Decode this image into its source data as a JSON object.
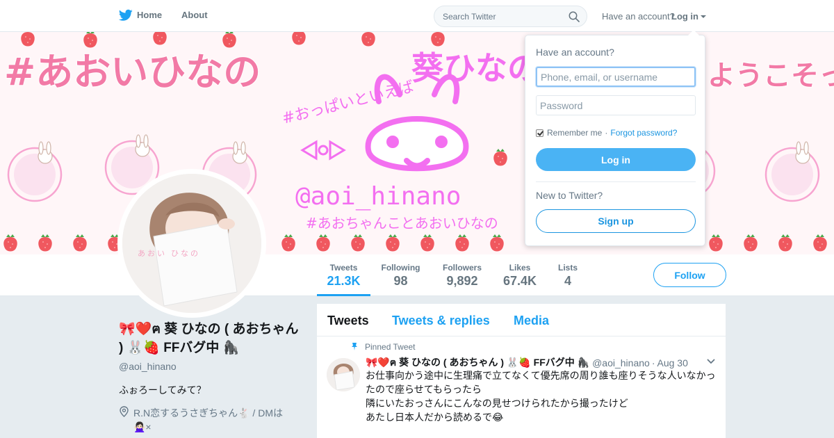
{
  "nav": {
    "logo_icon": "twitter-bird-icon",
    "home_label": "Home",
    "about_label": "About",
    "search_placeholder": "Search Twitter",
    "account_prompt": "Have an account?",
    "login_label": "Log in"
  },
  "banner": {
    "hashtag_left": "#あおいひなの",
    "hashtag_right": "ようこそっ!",
    "tagline": "#おっぱいといえば",
    "name_kanji": "葵ひなの",
    "handle": "@aoi_hinano",
    "subtag": "#あおちゃんことあおいひなの",
    "accent_color": "#f27aa6",
    "pink_color": "#f36ff0"
  },
  "avatar": {
    "caption": "あおい ひなの"
  },
  "stats": [
    {
      "label": "Tweets",
      "value": "21.3K"
    },
    {
      "label": "Following",
      "value": "98"
    },
    {
      "label": "Followers",
      "value": "9,892"
    },
    {
      "label": "Likes",
      "value": "67.4K"
    },
    {
      "label": "Lists",
      "value": "4"
    }
  ],
  "follow_label": "Follow",
  "profile": {
    "display_name": "🎀❤️ฅ 葵 ひなの ( あおちゃん ) 🐰🍓 FFバグ中 🦍",
    "handle": "@aoi_hinano",
    "bio": "ふぉろーしてみて？",
    "location": "R.N恋するうさぎちゃん🐇 / DMは🙅🏻‍♀️×"
  },
  "timeline": {
    "tabs": [
      "Tweets",
      "Tweets & replies",
      "Media"
    ],
    "pinned_label": "Pinned Tweet",
    "tweet": {
      "name": "🎀❤️ฅ 葵 ひなの ( あおちゃん ) 🐰🍓 FFバグ中 🦍",
      "handle": "@aoi_hinano",
      "separator": "·",
      "date": "Aug 30",
      "lines": [
        "お仕事向かう途中に生理痛で立てなくて優先席の周り誰も座りそうな人いなかっ",
        "たので座らせてもらったら",
        "隣にいたおっさんにこんなの見せつけられたから撮ったけど",
        "あたし日本人だから読めるで😂"
      ]
    }
  },
  "login_dropdown": {
    "title": "Have an account?",
    "username_placeholder": "Phone, email, or username",
    "password_placeholder": "Password",
    "remember_label": "Remember me",
    "dot": "·",
    "forgot_label": "Forgot password?",
    "login_button": "Log in",
    "new_prompt": "New to Twitter?",
    "signup_button": "Sign up"
  },
  "colors": {
    "twitter_blue": "#1da1f2",
    "login_button_blue": "#4ab3f4"
  }
}
